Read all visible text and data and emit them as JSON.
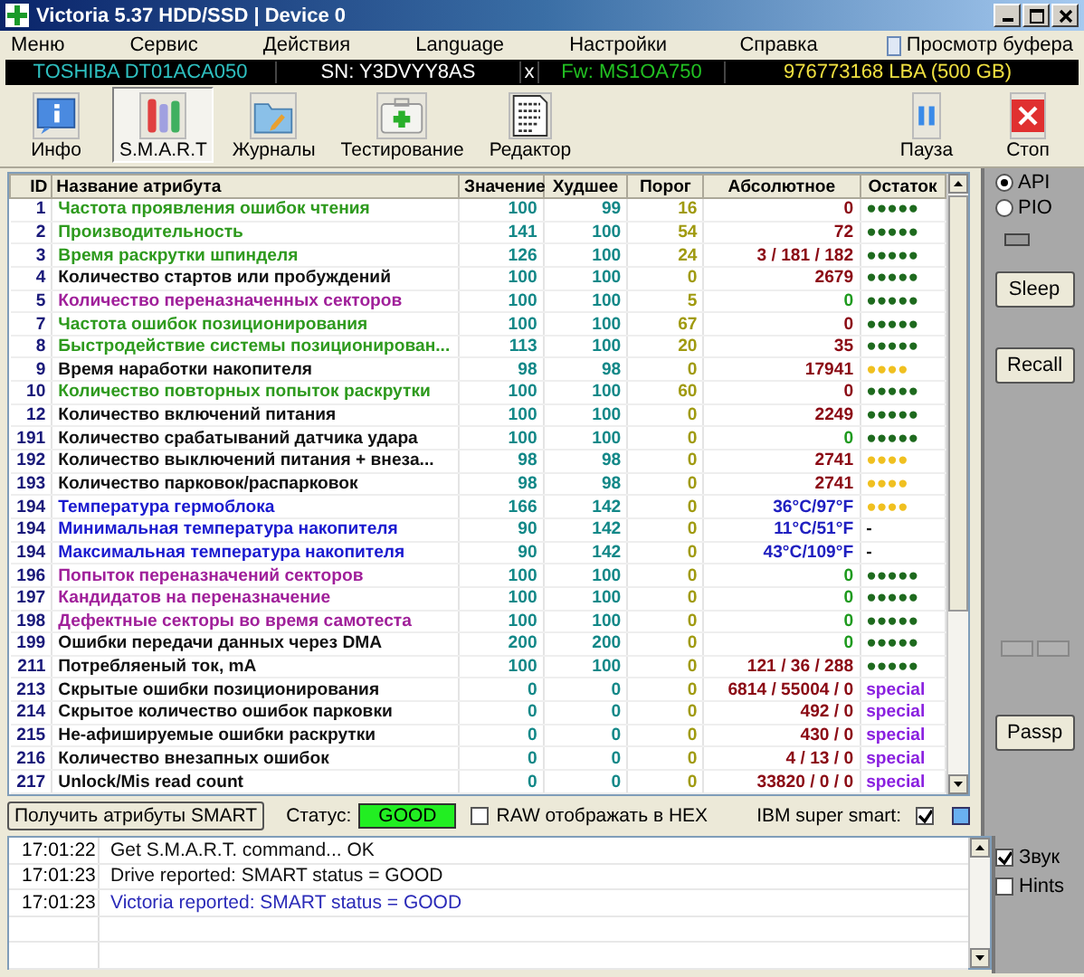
{
  "window": {
    "title": "Victoria 5.37 HDD/SSD | Device 0"
  },
  "menu": [
    "Меню",
    "Сервис",
    "Действия",
    "Language",
    "Настройки",
    "Справка"
  ],
  "buffer_view": "Просмотр буфера",
  "drive_bar": [
    {
      "text": "TOSHIBA DT01ACA050",
      "color": "#2ec0c0"
    },
    {
      "text": "SN: Y3DVYY8AS",
      "color": "#ffffff"
    },
    {
      "text": "x",
      "color": "#ffffff"
    },
    {
      "text": "Fw: MS1OA750",
      "color": "#22c022"
    },
    {
      "text": "976773168 LBA (500 GB)",
      "color": "#f0e040"
    }
  ],
  "toolbar": [
    {
      "kind": "info",
      "label": "Инфо",
      "selected": false
    },
    {
      "kind": "smart",
      "label": "S.M.A.R.T",
      "selected": true
    },
    {
      "kind": "logs",
      "label": "Журналы",
      "selected": false
    },
    {
      "kind": "test",
      "label": "Тестирование",
      "selected": false
    },
    {
      "kind": "editor",
      "label": "Редактор",
      "selected": false
    },
    {
      "kind": "pause",
      "label": "Пауза",
      "selected": false
    },
    {
      "kind": "stop",
      "label": "Стоп",
      "selected": false
    }
  ],
  "table": {
    "columns": [
      "ID",
      "Название атрибута",
      "Значение",
      "Худшее",
      "Порог",
      "Абсолютное",
      "Остаток"
    ],
    "rows": [
      {
        "id": "1",
        "name": "Частота проявления ошибок чтения",
        "color": "#2e9a1e",
        "value": "100",
        "worst": "99",
        "threshold": "16",
        "raw": {
          "text": "0",
          "color": "#8b0a14"
        },
        "remain": {
          "text": "●●●●●",
          "color": "#1e6a1e"
        }
      },
      {
        "id": "2",
        "name": "Производительность",
        "color": "#2e9a1e",
        "value": "141",
        "worst": "100",
        "threshold": "54",
        "raw": {
          "text": "72",
          "color": "#8b0a14"
        },
        "remain": {
          "text": "●●●●●",
          "color": "#1e6a1e"
        }
      },
      {
        "id": "3",
        "name": "Время раскрутки шпинделя",
        "color": "#2e9a1e",
        "value": "126",
        "worst": "100",
        "threshold": "24",
        "raw": {
          "text": "3 / 181 / 182",
          "color": "#8b0a14"
        },
        "remain": {
          "text": "●●●●●",
          "color": "#1e6a1e"
        }
      },
      {
        "id": "4",
        "name": "Количество стартов или пробуждений",
        "color": "#111111",
        "value": "100",
        "worst": "100",
        "threshold": "0",
        "raw": {
          "text": "2679",
          "color": "#8b0a14"
        },
        "remain": {
          "text": "●●●●●",
          "color": "#1e6a1e"
        }
      },
      {
        "id": "5",
        "name": "Количество переназначенных секторов",
        "color": "#a0209a",
        "value": "100",
        "worst": "100",
        "threshold": "5",
        "raw": {
          "text": "0",
          "color": "#1e9a1e"
        },
        "remain": {
          "text": "●●●●●",
          "color": "#1e6a1e"
        }
      },
      {
        "id": "7",
        "name": "Частота ошибок позиционирования",
        "color": "#2e9a1e",
        "value": "100",
        "worst": "100",
        "threshold": "67",
        "raw": {
          "text": "0",
          "color": "#8b0a14"
        },
        "remain": {
          "text": "●●●●●",
          "color": "#1e6a1e"
        }
      },
      {
        "id": "8",
        "name": "Быстродействие системы позиционирован...",
        "color": "#2e9a1e",
        "value": "113",
        "worst": "100",
        "threshold": "20",
        "raw": {
          "text": "35",
          "color": "#8b0a14"
        },
        "remain": {
          "text": "●●●●●",
          "color": "#1e6a1e"
        }
      },
      {
        "id": "9",
        "name": "Время наработки накопителя",
        "color": "#111111",
        "value": "98",
        "worst": "98",
        "threshold": "0",
        "raw": {
          "text": "17941",
          "color": "#8b0a14"
        },
        "remain": {
          "text": "●●●●",
          "color": "#f0c020"
        }
      },
      {
        "id": "10",
        "name": "Количество повторных попыток раскрутки",
        "color": "#2e9a1e",
        "value": "100",
        "worst": "100",
        "threshold": "60",
        "raw": {
          "text": "0",
          "color": "#8b0a14"
        },
        "remain": {
          "text": "●●●●●",
          "color": "#1e6a1e"
        }
      },
      {
        "id": "12",
        "name": "Количество включений питания",
        "color": "#111111",
        "value": "100",
        "worst": "100",
        "threshold": "0",
        "raw": {
          "text": "2249",
          "color": "#8b0a14"
        },
        "remain": {
          "text": "●●●●●",
          "color": "#1e6a1e"
        }
      },
      {
        "id": "191",
        "name": "Количество срабатываний датчика удара",
        "color": "#111111",
        "value": "100",
        "worst": "100",
        "threshold": "0",
        "raw": {
          "text": "0",
          "color": "#1e9a1e"
        },
        "remain": {
          "text": "●●●●●",
          "color": "#1e6a1e"
        }
      },
      {
        "id": "192",
        "name": "Количество выключений питания + внеза...",
        "color": "#111111",
        "value": "98",
        "worst": "98",
        "threshold": "0",
        "raw": {
          "text": "2741",
          "color": "#8b0a14"
        },
        "remain": {
          "text": "●●●●",
          "color": "#f0c020"
        }
      },
      {
        "id": "193",
        "name": "Количество парковок/распарковок",
        "color": "#111111",
        "value": "98",
        "worst": "98",
        "threshold": "0",
        "raw": {
          "text": "2741",
          "color": "#8b0a14"
        },
        "remain": {
          "text": "●●●●",
          "color": "#f0c020"
        }
      },
      {
        "id": "194",
        "name": "Температура гермоблока",
        "color": "#1a1ad0",
        "value": "166",
        "worst": "142",
        "threshold": "0",
        "raw": {
          "text": "36°C/97°F",
          "color": "#2020c0"
        },
        "remain": {
          "text": "●●●●",
          "color": "#f0c020"
        }
      },
      {
        "id": "194",
        "name": "Минимальная температура накопителя",
        "color": "#1a1ad0",
        "value": "90",
        "worst": "142",
        "threshold": "0",
        "raw": {
          "text": "11°C/51°F",
          "color": "#2020c0"
        },
        "remain": {
          "text": "-",
          "color": "#111111"
        }
      },
      {
        "id": "194",
        "name": "Максимальная температура накопителя",
        "color": "#1a1ad0",
        "value": "90",
        "worst": "142",
        "threshold": "0",
        "raw": {
          "text": "43°C/109°F",
          "color": "#2020c0"
        },
        "remain": {
          "text": "-",
          "color": "#111111"
        }
      },
      {
        "id": "196",
        "name": "Попыток переназначений секторов",
        "color": "#a0209a",
        "value": "100",
        "worst": "100",
        "threshold": "0",
        "raw": {
          "text": "0",
          "color": "#1e9a1e"
        },
        "remain": {
          "text": "●●●●●",
          "color": "#1e6a1e"
        }
      },
      {
        "id": "197",
        "name": "Кандидатов на переназначение",
        "color": "#a0209a",
        "value": "100",
        "worst": "100",
        "threshold": "0",
        "raw": {
          "text": "0",
          "color": "#1e9a1e"
        },
        "remain": {
          "text": "●●●●●",
          "color": "#1e6a1e"
        }
      },
      {
        "id": "198",
        "name": "Дефектные секторы во время самотеста",
        "color": "#a0209a",
        "value": "100",
        "worst": "100",
        "threshold": "0",
        "raw": {
          "text": "0",
          "color": "#1e9a1e"
        },
        "remain": {
          "text": "●●●●●",
          "color": "#1e6a1e"
        }
      },
      {
        "id": "199",
        "name": "Ошибки передачи данных через DMA",
        "color": "#111111",
        "value": "200",
        "worst": "200",
        "threshold": "0",
        "raw": {
          "text": "0",
          "color": "#1e9a1e"
        },
        "remain": {
          "text": "●●●●●",
          "color": "#1e6a1e"
        }
      },
      {
        "id": "211",
        "name": "Потребляеный ток, mA",
        "color": "#111111",
        "value": "100",
        "worst": "100",
        "threshold": "0",
        "raw": {
          "text": "121 / 36 / 288",
          "color": "#8b0a14"
        },
        "remain": {
          "text": "●●●●●",
          "color": "#1e6a1e"
        }
      },
      {
        "id": "213",
        "name": "Скрытые ошибки позиционирования",
        "color": "#111111",
        "value": "0",
        "worst": "0",
        "threshold": "0",
        "raw": {
          "text": "6814 / 55004 / 0",
          "color": "#8b0a14"
        },
        "remain": {
          "text": "special",
          "color": "#8a20e0"
        }
      },
      {
        "id": "214",
        "name": "Скрытое количество ошибок парковки",
        "color": "#111111",
        "value": "0",
        "worst": "0",
        "threshold": "0",
        "raw": {
          "text": "492 / 0",
          "color": "#8b0a14"
        },
        "remain": {
          "text": "special",
          "color": "#8a20e0"
        }
      },
      {
        "id": "215",
        "name": "Не-афишируемые ошибки раскрутки",
        "color": "#111111",
        "value": "0",
        "worst": "0",
        "threshold": "0",
        "raw": {
          "text": "430 / 0",
          "color": "#8b0a14"
        },
        "remain": {
          "text": "special",
          "color": "#8a20e0"
        }
      },
      {
        "id": "216",
        "name": "Количество внезапных ошибок",
        "color": "#111111",
        "value": "0",
        "worst": "0",
        "threshold": "0",
        "raw": {
          "text": "4 / 13 / 0",
          "color": "#8b0a14"
        },
        "remain": {
          "text": "special",
          "color": "#8a20e0"
        }
      },
      {
        "id": "217",
        "name": "Unlock/Mis read count",
        "color": "#111111",
        "value": "0",
        "worst": "0",
        "threshold": "0",
        "raw": {
          "text": "33820 / 0 / 0",
          "color": "#8b0a14"
        },
        "remain": {
          "text": "special",
          "color": "#8a20e0"
        }
      }
    ]
  },
  "right_panel": {
    "modes": [
      {
        "label": "API",
        "selected": true
      },
      {
        "label": "PIO",
        "selected": false
      }
    ],
    "buttons": [
      {
        "kind": "button",
        "label": "Sleep"
      },
      {
        "kind": "button",
        "label": "Recall"
      },
      {
        "kind": "mini_pair"
      },
      {
        "kind": "button",
        "label": "Passp"
      }
    ]
  },
  "bottom_bar": {
    "get_button": "Получить атрибуты SMART",
    "status_label": "Статус:",
    "status": "GOOD",
    "hex": {
      "label": "RAW отображать в HEX",
      "checked": false
    },
    "ibm": {
      "label": "IBM super smart:",
      "checked": true
    }
  },
  "log": [
    {
      "time": "17:01:22",
      "message": "Get S.M.A.R.T. command... OK",
      "color": "#111111"
    },
    {
      "time": "17:01:23",
      "message": "Drive reported: SMART status = GOOD",
      "color": "#111111"
    },
    {
      "time": "17:01:23",
      "message": "Victoria reported: SMART status = GOOD",
      "color": "#2a2ab8"
    }
  ],
  "options": [
    {
      "label": "Звук",
      "checked": true
    },
    {
      "label": "Hints",
      "checked": false
    }
  ]
}
